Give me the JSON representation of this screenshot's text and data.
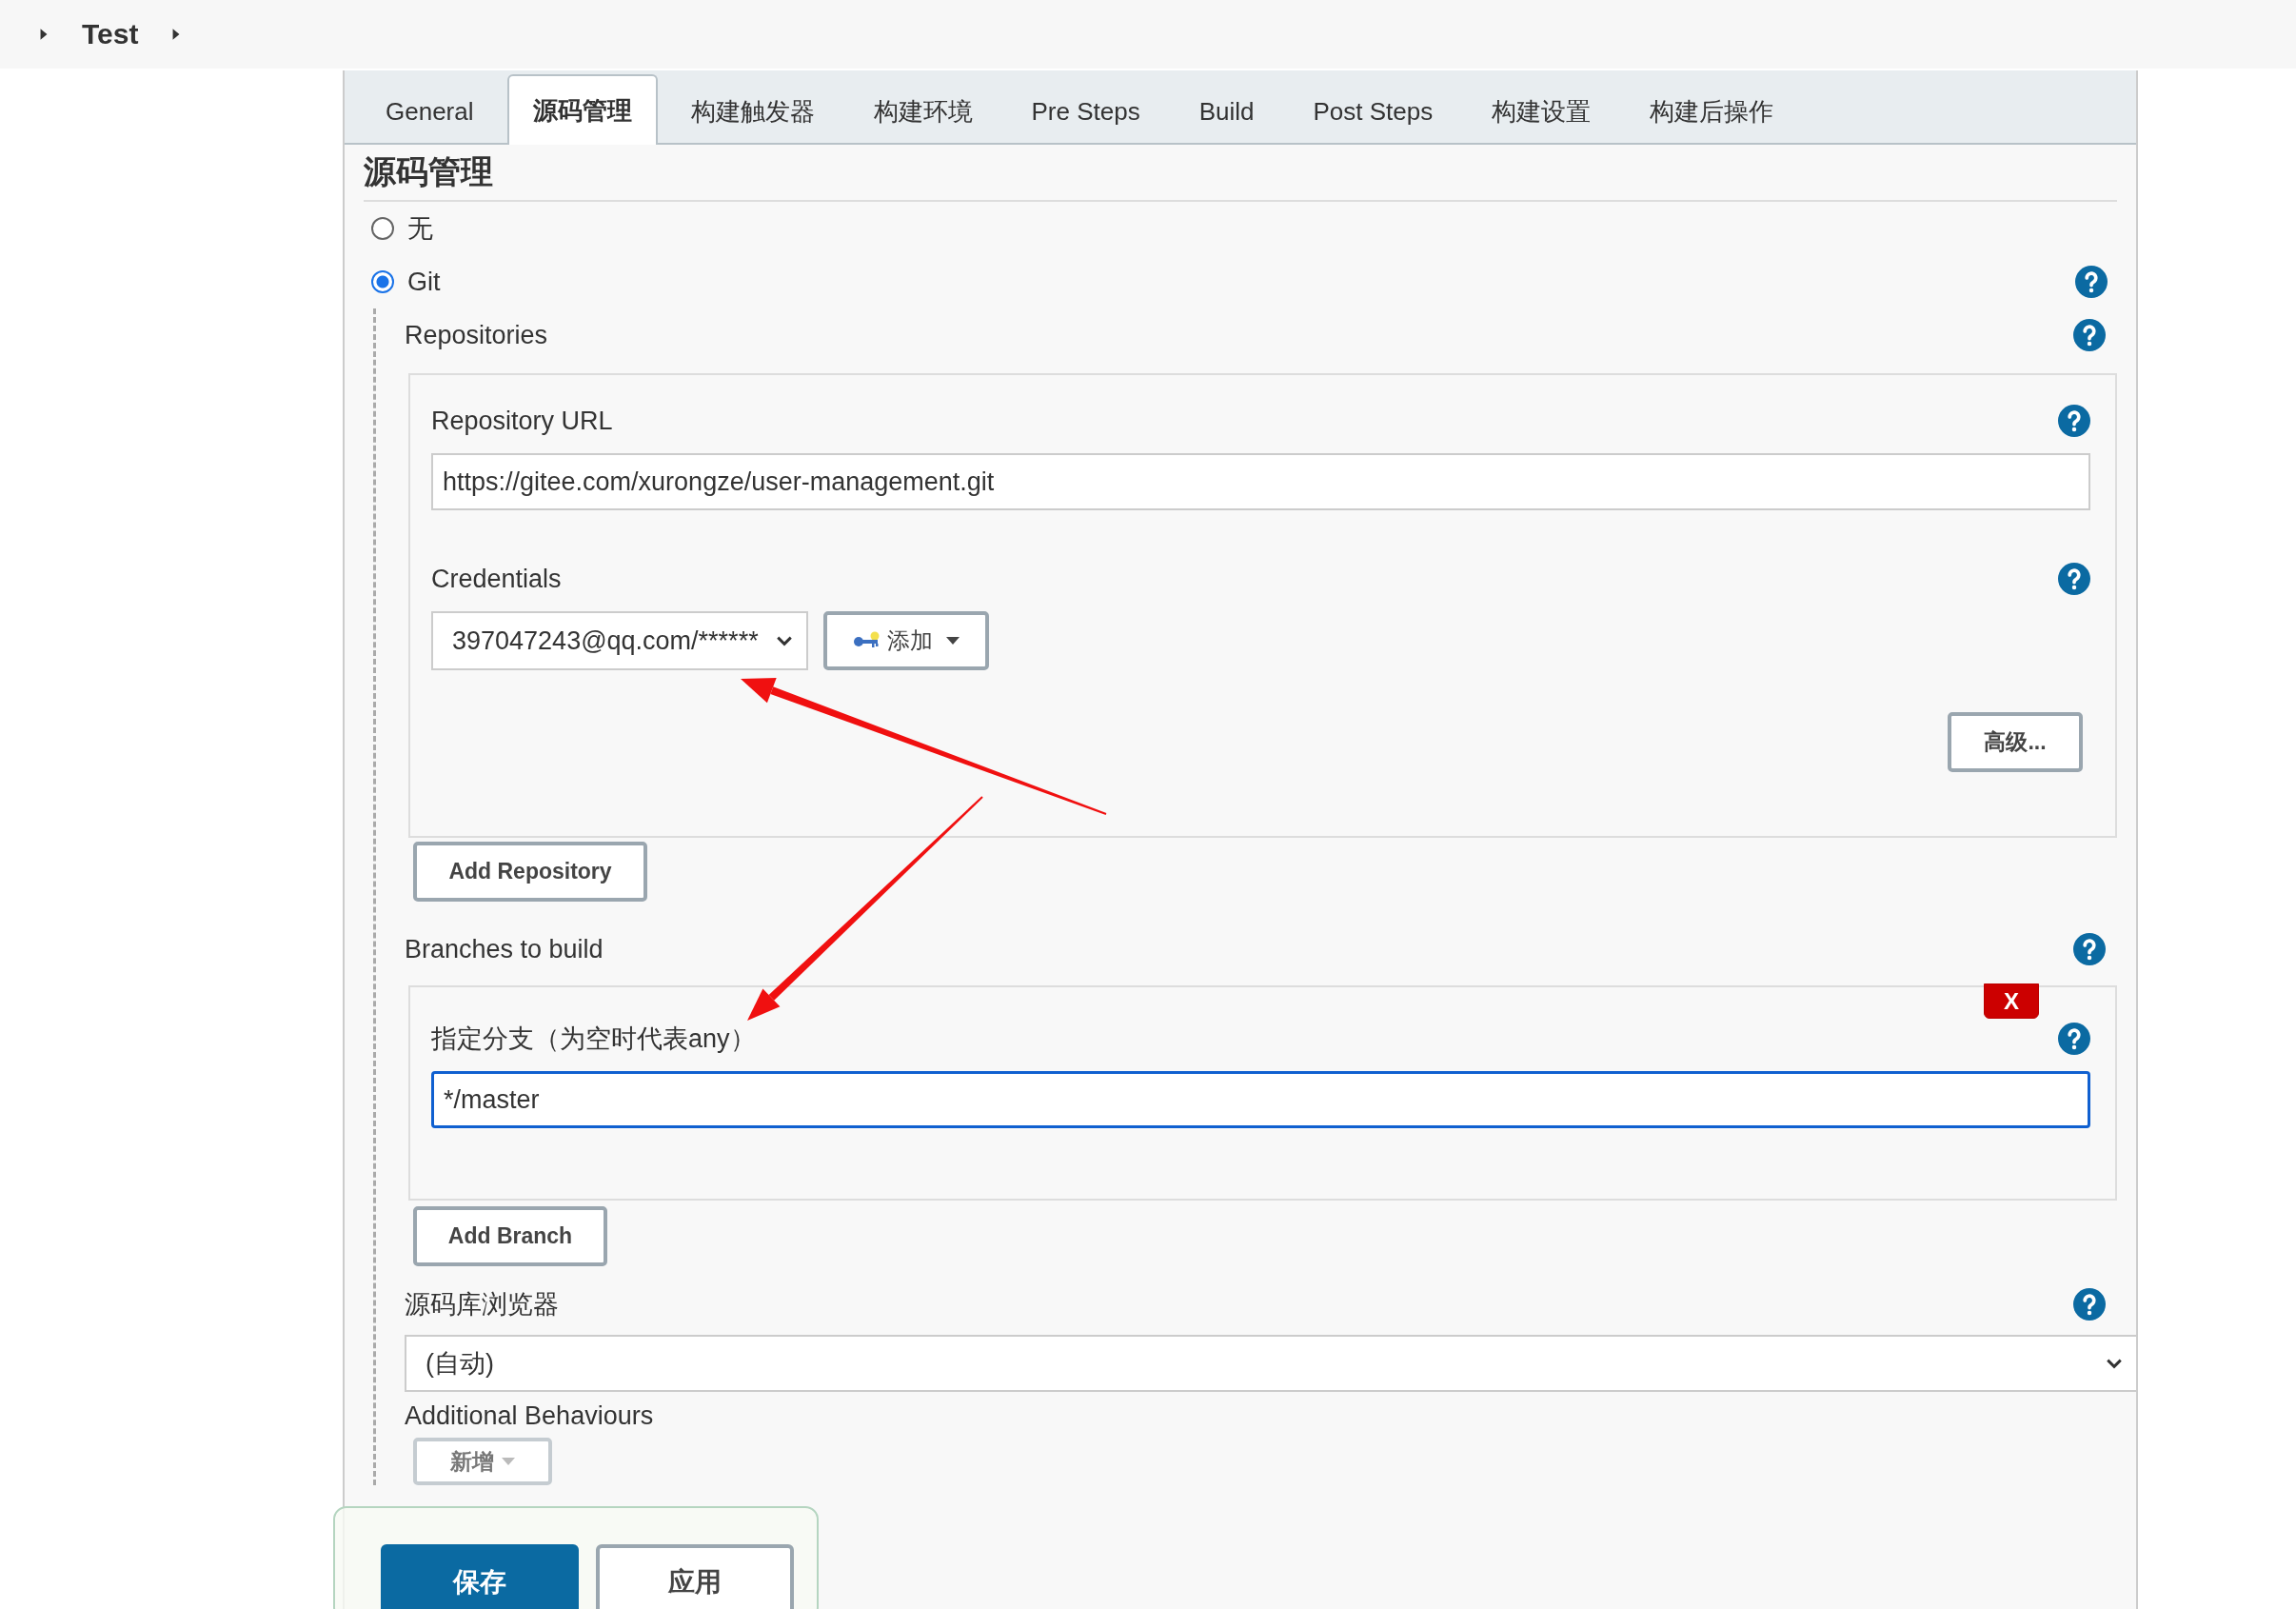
{
  "breadcrumb": "Test",
  "tabs": [
    {
      "label": "General",
      "selected": false
    },
    {
      "label": "源码管理",
      "selected": true
    },
    {
      "label": "构建触发器",
      "selected": false
    },
    {
      "label": "构建环境",
      "selected": false
    },
    {
      "label": "Pre Steps",
      "selected": false
    },
    {
      "label": "Build",
      "selected": false
    },
    {
      "label": "Post Steps",
      "selected": false
    },
    {
      "label": "构建设置",
      "selected": false
    },
    {
      "label": "构建后操作",
      "selected": false
    }
  ],
  "section_title": "源码管理",
  "scm_options": [
    {
      "label": "无",
      "selected": false
    },
    {
      "label": "Git",
      "selected": true
    }
  ],
  "repositories": {
    "label": "Repositories",
    "items": [
      {
        "url_label": "Repository URL",
        "url": "https://gitee.com/xurongze/user-management.git",
        "credentials_label": "Credentials",
        "credential": "397047243@qq.com/******",
        "add_button": "添加",
        "advanced_button": "高级..."
      }
    ],
    "add_button": "Add Repository"
  },
  "branches": {
    "label": "Branches to build",
    "items": [
      {
        "label": "指定分支（为空时代表any）",
        "value": "*/master",
        "focused": true,
        "delete_button": "X"
      }
    ],
    "add_button": "Add Branch"
  },
  "browser": {
    "label": "源码库浏览器",
    "value": "(自动)"
  },
  "additional_behaviours": {
    "label": "Additional Behaviours",
    "add_button": "新增"
  },
  "footer_buttons": [
    {
      "label": "保存",
      "kind": "primary"
    },
    {
      "label": "应用",
      "kind": "secondary"
    }
  ]
}
